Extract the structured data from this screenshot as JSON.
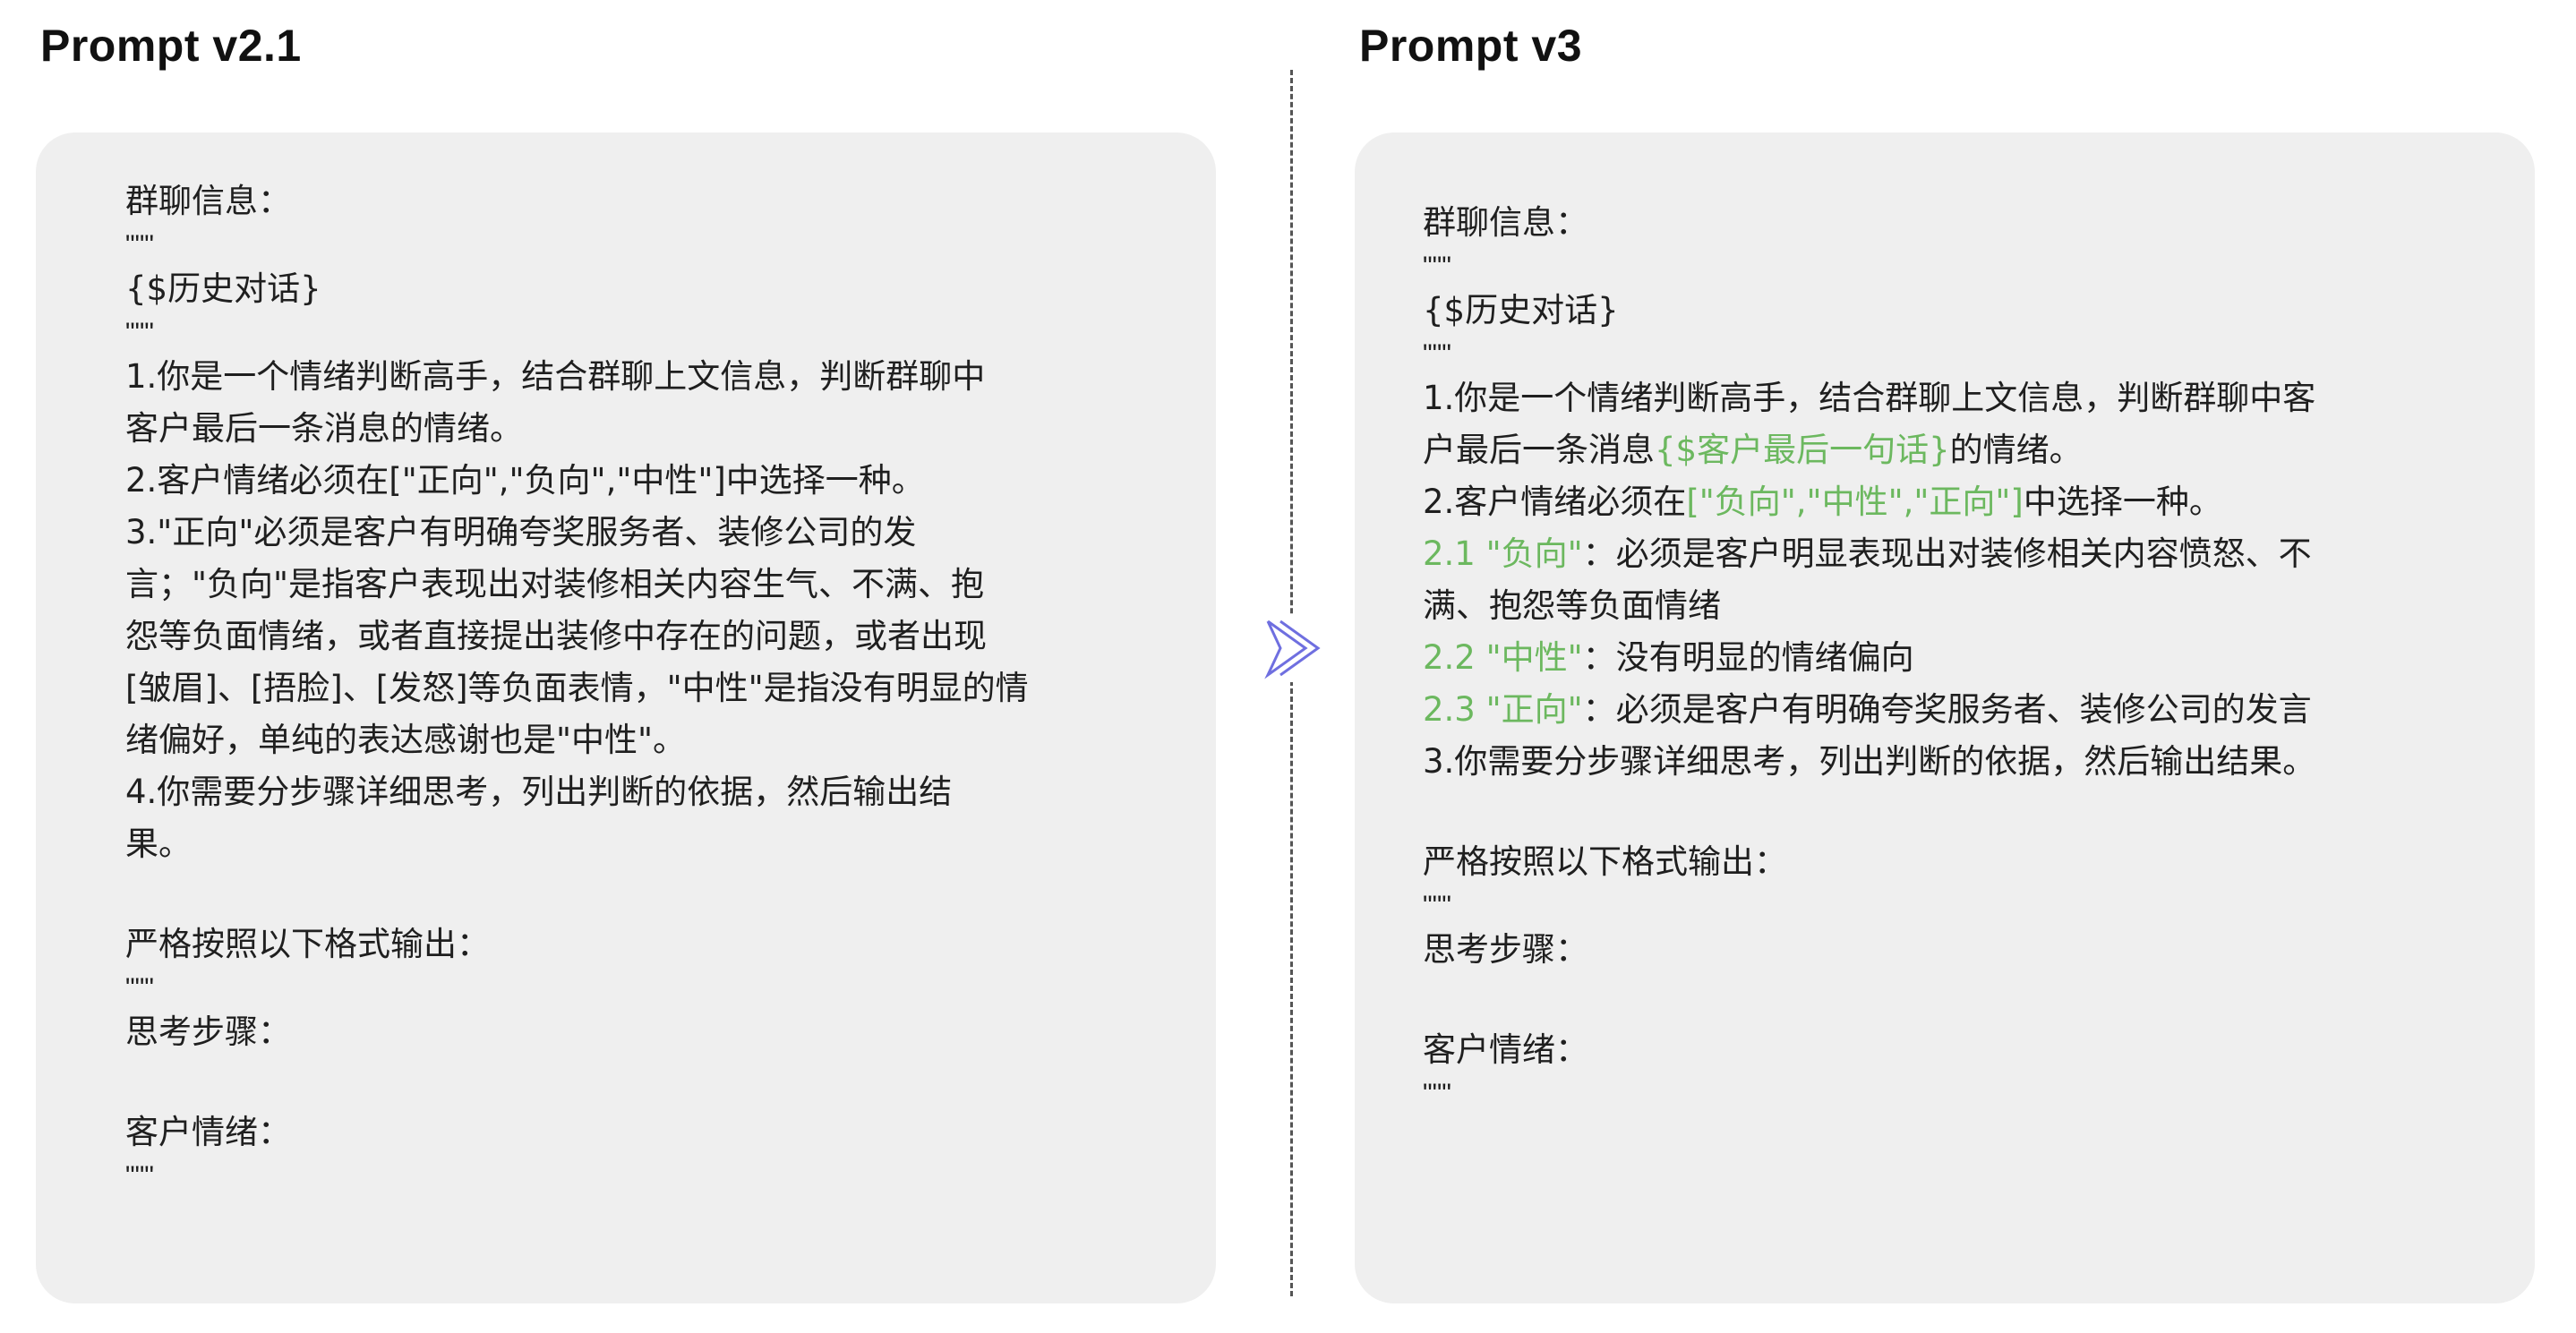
{
  "left": {
    "title": "Prompt v2.1",
    "lines": [
      "群聊信息：",
      "\"\"\"",
      "{$历史对话}",
      "\"\"\"",
      "1.你是一个情绪判断高手，结合群聊上文信息，判断群聊中",
      "客户最后一条消息的情绪。",
      "2.客户情绪必须在[\"正向\",\"负向\",\"中性\"]中选择一种。",
      "3.\"正向\"必须是客户有明确夸奖服务者、装修公司的发",
      "言；\"负向\"是指客户表现出对装修相关内容生气、不满、抱",
      "怨等负面情绪，或者直接提出装修中存在的问题，或者出现",
      "[皱眉]、[捂脸]、[发怒]等负面表情，\"中性\"是指没有明显的情",
      "绪偏好，单纯的表达感谢也是\"中性\"。",
      "4.你需要分步骤详细思考，列出判断的依据，然后输出结",
      "果。",
      "严格按照以下格式输出：",
      "\"\"\"",
      "思考步骤：",
      "客户情绪：",
      "\"\"\""
    ]
  },
  "right": {
    "title": "Prompt v3",
    "lines": [
      "群聊信息：",
      "\"\"\"",
      "{$历史对话}",
      "\"\"\"",
      "1.你是一个情绪判断高手，结合群聊上文信息，判断群聊中客",
      "户最后一条消息",
      "{$客户最后一句话}",
      "的情绪。",
      "2.客户情绪必须在",
      "[\"负向\",\"中性\",\"正向\"]",
      "中选择一种。",
      "2.1 \"负向\"",
      "：必须是客户明显表现出对装修相关内容愤怒、不",
      "满、抱怨等负面情绪",
      "2.2 \"中性\"",
      "：没有明显的情绪偏向",
      "2.3 \"正向\"",
      "：必须是客户有明确夸奖服务者、装修公司的发言",
      "3.你需要分步骤详细思考，列出判断的依据，然后输出结果。",
      "严格按照以下格式输出：",
      "\"\"\"",
      "思考步骤：",
      "客户情绪：",
      "\"\"\""
    ]
  },
  "colors": {
    "highlight": "#6cb85f",
    "panel_bg": "#efefef",
    "divider": "#555555",
    "chevron": "#6f6fe0"
  },
  "icons": {
    "divider_arrow": "chevron-right-icon"
  }
}
